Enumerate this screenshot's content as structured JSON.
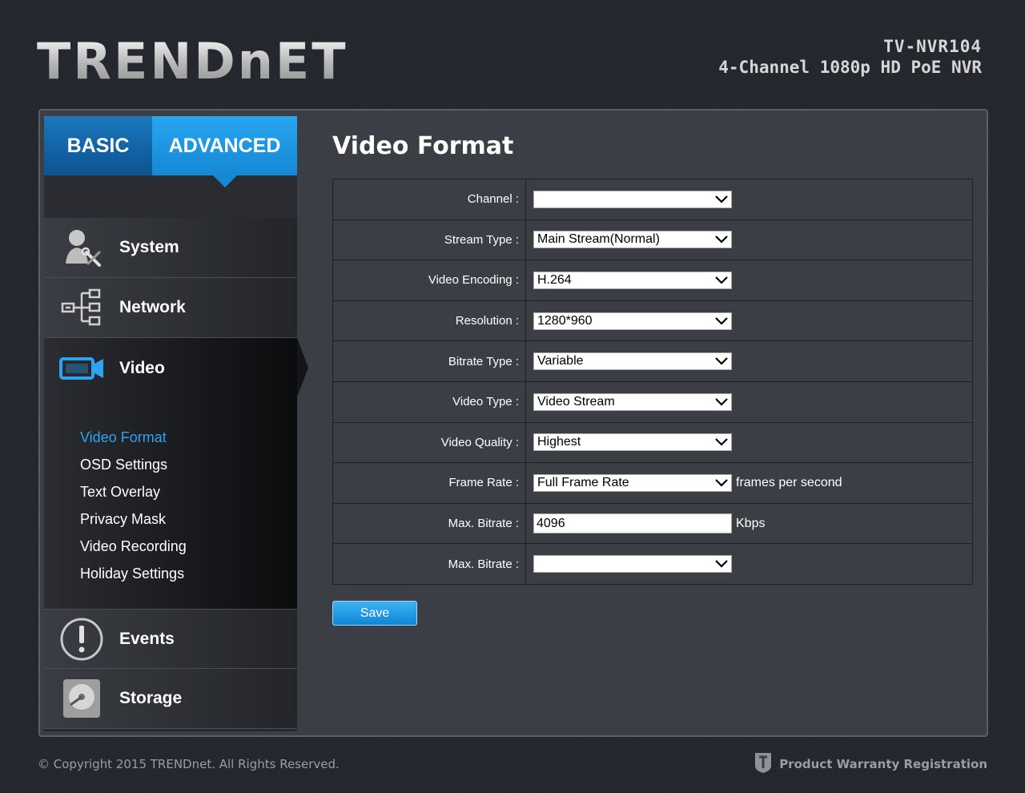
{
  "brand": {
    "logo": "TRENDnET"
  },
  "header": {
    "model": "TV-NVR104",
    "description": "4-Channel 1080p HD PoE NVR"
  },
  "tabs": [
    {
      "label": "BASIC",
      "active": false
    },
    {
      "label": "ADVANCED",
      "active": true
    }
  ],
  "sidebar": {
    "items": [
      {
        "label": "System",
        "icon": "system-user-tools-icon"
      },
      {
        "label": "Network",
        "icon": "network-tree-icon"
      },
      {
        "label": "Video",
        "icon": "video-camera-icon",
        "active": true
      },
      {
        "label": "Events",
        "icon": "exclamation-circle-icon"
      },
      {
        "label": "Storage",
        "icon": "hard-drive-icon"
      }
    ],
    "video_subitems": [
      {
        "label": "Video Format",
        "active": true
      },
      {
        "label": "OSD Settings"
      },
      {
        "label": "Text Overlay"
      },
      {
        "label": "Privacy Mask"
      },
      {
        "label": "Video Recording"
      },
      {
        "label": "Holiday Settings"
      }
    ]
  },
  "main": {
    "title": "Video Format",
    "rows": [
      {
        "label": "Channel :",
        "type": "select",
        "value": ""
      },
      {
        "label": "Stream Type :",
        "type": "select",
        "value": "Main Stream(Normal)"
      },
      {
        "label": "Video Encoding :",
        "type": "select",
        "value": "H.264"
      },
      {
        "label": "Resolution :",
        "type": "select",
        "value": "1280*960"
      },
      {
        "label": "Bitrate Type :",
        "type": "select",
        "value": "Variable"
      },
      {
        "label": "Video Type :",
        "type": "select",
        "value": "Video Stream"
      },
      {
        "label": "Video Quality :",
        "type": "select",
        "value": "Highest"
      },
      {
        "label": "Frame Rate :",
        "type": "select",
        "value": "Full Frame Rate",
        "unit": "frames per second"
      },
      {
        "label": "Max. Bitrate :",
        "type": "input",
        "value": "4096",
        "unit": "Kbps"
      },
      {
        "label": "Max. Bitrate :",
        "type": "select",
        "value": ""
      }
    ],
    "save_label": "Save"
  },
  "footer": {
    "copyright": "© Copyright 2015 TRENDnet. All Rights Reserved.",
    "warranty": "Product Warranty Registration"
  },
  "colors": {
    "accent": "#1e96e8",
    "active_link": "#2ea3f2",
    "background": "#23262c",
    "panel": "#3b3e45"
  }
}
